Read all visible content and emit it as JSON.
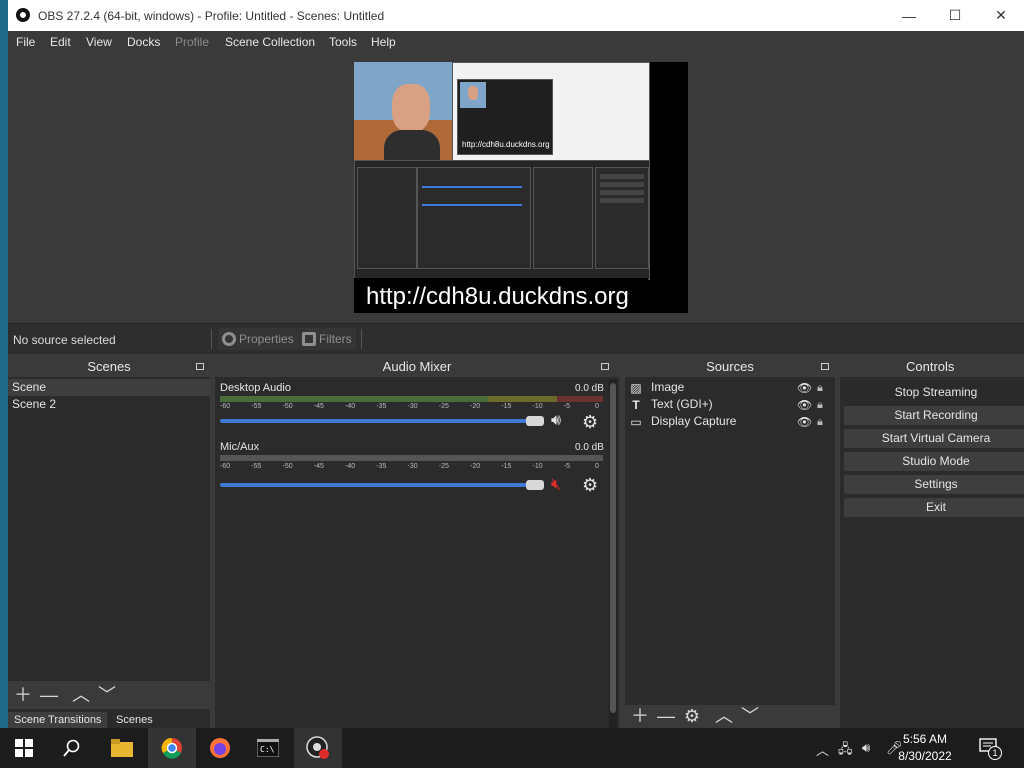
{
  "window": {
    "title": "OBS 27.2.4 (64-bit, windows) - Profile: Untitled - Scenes: Untitled",
    "minimize_glyph": "—",
    "maximize_glyph": "☐",
    "close_glyph": "✕"
  },
  "menu": {
    "items": [
      "File",
      "Edit",
      "View",
      "Docks",
      "Profile",
      "Scene Collection",
      "Tools",
      "Help"
    ]
  },
  "preview": {
    "nested_url": "http://cdh8u.duckdns.org",
    "url_overlay": "http://cdh8u.duckdns.org"
  },
  "source_strip": {
    "status": "No source selected",
    "properties_label": "Properties",
    "filters_label": "Filters"
  },
  "scenes": {
    "title": "Scenes",
    "items": [
      "Scene",
      "Scene 2"
    ],
    "selected": 0
  },
  "audio_mixer": {
    "title": "Audio Mixer",
    "tick_labels": [
      "-60",
      "-55",
      "-50",
      "-45",
      "-40",
      "-35",
      "-30",
      "-25",
      "-20",
      "-15",
      "-10",
      "-5",
      "0"
    ],
    "channels": [
      {
        "name": "Desktop Audio",
        "db": "0.0 dB",
        "muted": false,
        "volume": 1.0
      },
      {
        "name": "Mic/Aux",
        "db": "0.0 dB",
        "muted": true,
        "volume": 1.0
      }
    ]
  },
  "sources": {
    "title": "Sources",
    "items": [
      {
        "name": "Image",
        "icon": "image-icon"
      },
      {
        "name": "Text (GDI+)",
        "icon": "text-icon"
      },
      {
        "name": "Display Capture",
        "icon": "monitor-icon"
      }
    ]
  },
  "controls": {
    "title": "Controls",
    "buttons": [
      "Stop Streaming",
      "Start Recording",
      "Start Virtual Camera",
      "Studio Mode",
      "Settings",
      "Exit"
    ]
  },
  "bottom_tabs": {
    "scene_transitions": "Scene Transitions",
    "scenes": "Scenes"
  },
  "taskbar": {
    "time": "5:56 AM",
    "date": "8/30/2022",
    "notification_count": "1"
  },
  "colors": {
    "accent": "#3f7bd6",
    "mute": "#e02b2b",
    "panel": "#2b2b2b",
    "header": "#3a3a3a"
  }
}
